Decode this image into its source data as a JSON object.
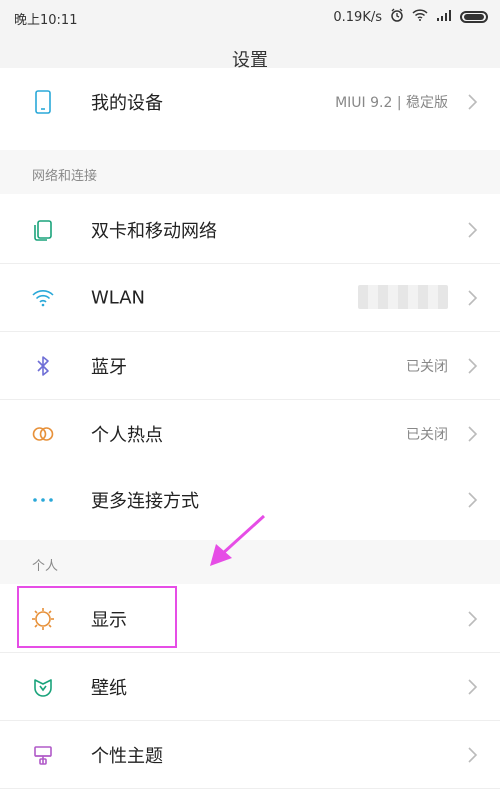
{
  "status": {
    "time": "晚上10:11",
    "speed": "0.19K/s"
  },
  "title": "设置",
  "top_item": {
    "label": "我的设备",
    "value": "MIUI 9.2 | 稳定版"
  },
  "sections": [
    {
      "title": "网络和连接",
      "items": [
        {
          "label": "双卡和移动网络",
          "value": "",
          "icon": "sim-card-icon",
          "color": "#1aa37b"
        },
        {
          "label": "WLAN",
          "value": "",
          "icon": "wifi-icon",
          "color": "#2aa8d8"
        },
        {
          "label": "蓝牙",
          "value": "已关闭",
          "icon": "bluetooth-icon",
          "color": "#6f6fd6"
        },
        {
          "label": "个人热点",
          "value": "已关闭",
          "icon": "hotspot-icon",
          "color": "#e7913a"
        },
        {
          "label": "更多连接方式",
          "value": "",
          "icon": "more-dots-icon",
          "color": "#2aa8d8"
        }
      ]
    },
    {
      "title": "个人",
      "items": [
        {
          "label": "显示",
          "value": "",
          "icon": "display-brightness-icon",
          "color": "#e7913a"
        },
        {
          "label": "壁纸",
          "value": "",
          "icon": "wallpaper-icon",
          "color": "#1aa37b"
        },
        {
          "label": "个性主题",
          "value": "",
          "icon": "theme-icon",
          "color": "#b05ac8"
        }
      ]
    }
  ],
  "colors": {
    "highlight": "#e64de6",
    "arrow": "#e64de6"
  }
}
